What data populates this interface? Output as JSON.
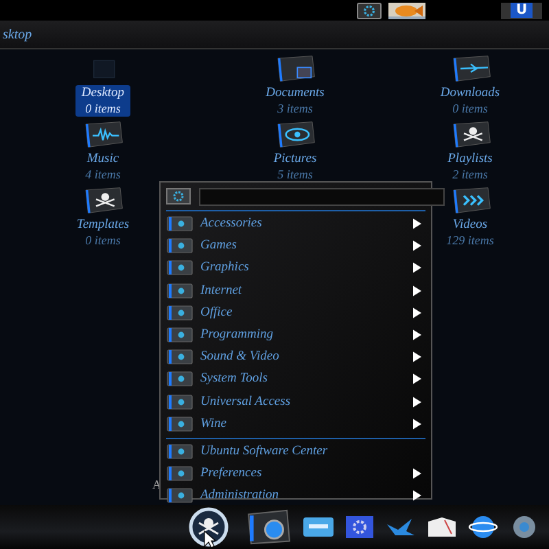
{
  "top_bar": {
    "user_badge": "U"
  },
  "location": {
    "path": "sktop"
  },
  "files": [
    {
      "name": "Desktop",
      "count": "0 items",
      "kind": "blank",
      "selected": true
    },
    {
      "name": "Documents",
      "count": "3 items",
      "kind": "document",
      "selected": false
    },
    {
      "name": "Downloads",
      "count": "0 items",
      "kind": "download",
      "selected": false
    },
    {
      "name": "Music",
      "count": "4 items",
      "kind": "wave",
      "selected": false
    },
    {
      "name": "Pictures",
      "count": "5 items",
      "kind": "eye",
      "selected": false
    },
    {
      "name": "Playlists",
      "count": "2 items",
      "kind": "skull",
      "selected": false
    },
    {
      "name": "Templates",
      "count": "0 items",
      "kind": "skull",
      "selected": false
    },
    {
      "name": "Videos",
      "count": "129 items",
      "kind": "play",
      "selected": false
    }
  ],
  "stray_label": "A",
  "menu": {
    "sections": [
      [
        {
          "label": "Accessories",
          "has_submenu": true
        },
        {
          "label": "Games",
          "has_submenu": true
        },
        {
          "label": "Graphics",
          "has_submenu": true
        },
        {
          "label": "Internet",
          "has_submenu": true
        },
        {
          "label": "Office",
          "has_submenu": true
        },
        {
          "label": "Programming",
          "has_submenu": true
        },
        {
          "label": "Sound & Video",
          "has_submenu": true
        },
        {
          "label": "System Tools",
          "has_submenu": true
        },
        {
          "label": "Universal Access",
          "has_submenu": true
        },
        {
          "label": "Wine",
          "has_submenu": true
        }
      ],
      [
        {
          "label": "Ubuntu Software Center",
          "has_submenu": false
        },
        {
          "label": "Preferences",
          "has_submenu": true
        },
        {
          "label": "Administration",
          "has_submenu": true
        }
      ]
    ]
  }
}
